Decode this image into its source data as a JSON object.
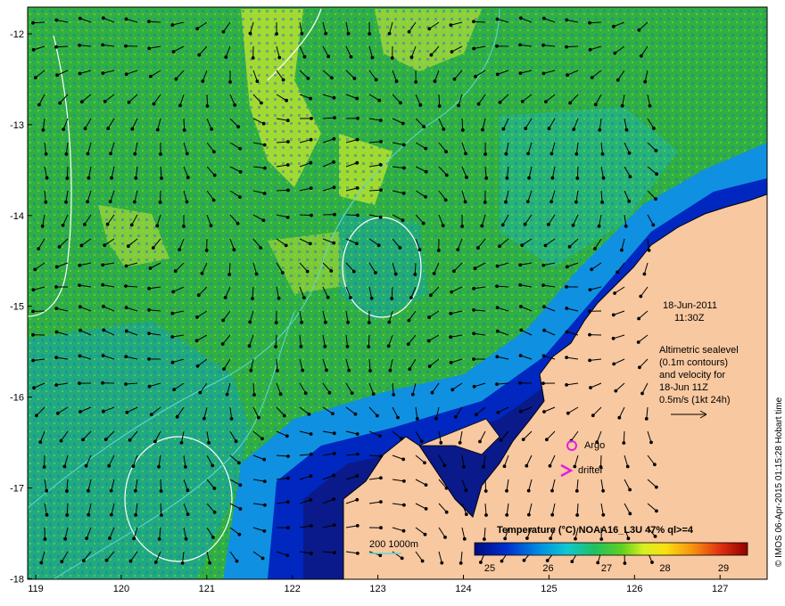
{
  "map": {
    "lon_ticks": [
      "119",
      "120",
      "121",
      "122",
      "123",
      "124",
      "125",
      "126",
      "127"
    ],
    "lat_ticks": [
      "-12",
      "-13",
      "-14",
      "-15",
      "-16",
      "-17",
      "-18"
    ],
    "date_line1": "18-Jun-2011",
    "date_line2": "11:30Z",
    "altimetry_lines": [
      "Altimetric sealevel",
      "(0.1m contours)",
      "and velocity for",
      "18-Jun 11Z",
      "0.5m/s (1kt 24h)"
    ],
    "argo_label": "Argo",
    "drifter_label": "drifter",
    "depth_label": "200  1000m",
    "credit": "© IMOS 06-Apr-2015 01:15:28 Hobart time",
    "colorbar": {
      "title": "Temperature (°C) NOAA16_L3U 47% ql>=4",
      "ticks": [
        "25",
        "26",
        "27",
        "28",
        "29"
      ]
    },
    "colors": {
      "land": "#f8c8a0",
      "ocean_green": "#30b848",
      "ocean_cool": "#18a8a0",
      "coast_deep": "#0a1a8a",
      "contour": "#ffffff",
      "bathy": "#60d8d8",
      "argo_marker": "#e020e0"
    }
  }
}
